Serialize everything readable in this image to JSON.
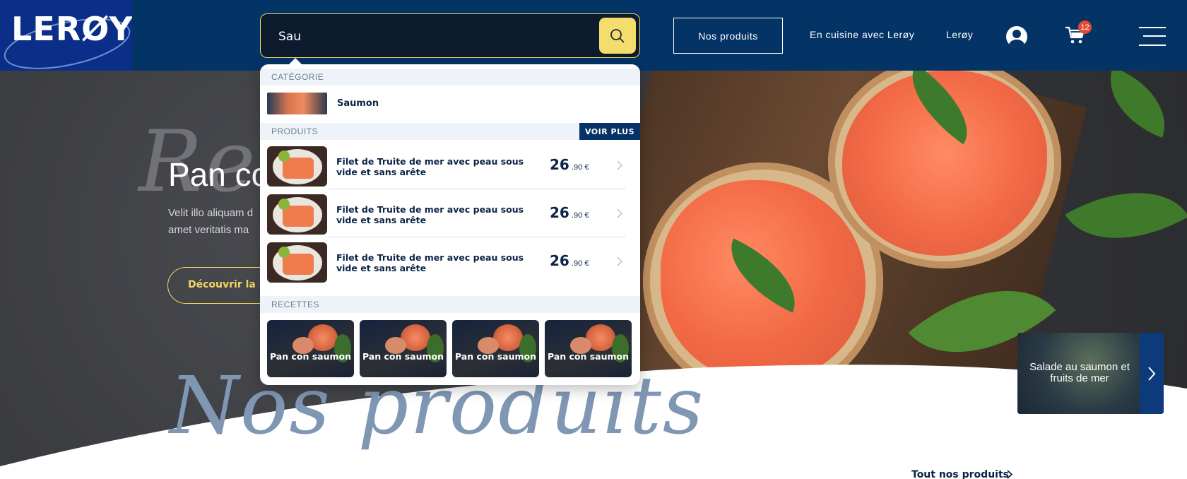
{
  "brand": {
    "logo_text": "LERØY"
  },
  "search": {
    "value": "Sau",
    "placeholder": ""
  },
  "nav": {
    "products_button": "Nos produits",
    "cooking_link": "En cuisine avec Lerøy",
    "leroy_link": "Lerøy",
    "cart_count": "12"
  },
  "hero": {
    "script_bg": "Rec",
    "title": "Pan co",
    "description_line1": "Velit illo aliquam d",
    "description_line2": "amet veritatis ma",
    "cta": "Découvrir la re"
  },
  "featured_card": {
    "label": "Salade au saumon et fruits de mer"
  },
  "products_section": {
    "script_title": "Nos produits",
    "all_link": "Tout nos produits"
  },
  "dropdown": {
    "category_header": "CATÉGORIE",
    "category_item": "Saumon",
    "products_header": "PRODUITS",
    "see_more": "VOIR PLUS",
    "products": [
      {
        "name": "Filet de Truite de mer avec peau sous vide et sans arête",
        "price_int": "26",
        "price_dec": ".90 €"
      },
      {
        "name": "Filet de Truite de mer avec peau sous vide et sans arête",
        "price_int": "26",
        "price_dec": ".90 €"
      },
      {
        "name": "Filet de Truite de mer avec peau sous vide et sans arête",
        "price_int": "26",
        "price_dec": ".90 €"
      }
    ],
    "recipes_header": "RECETTES",
    "recipes": [
      {
        "label": "Pan con saumon"
      },
      {
        "label": "Pan con saumon"
      },
      {
        "label": "Pan con saumon"
      },
      {
        "label": "Pan con saumon"
      }
    ]
  },
  "colors": {
    "header_bg": "#043366",
    "accent_yellow": "#f4dc6d",
    "text_dark": "#0a2446",
    "voir_plus_bg": "#073266"
  },
  "icons": [
    "search-icon",
    "user-icon",
    "cart-icon",
    "menu-icon",
    "chevron-right-icon"
  ]
}
